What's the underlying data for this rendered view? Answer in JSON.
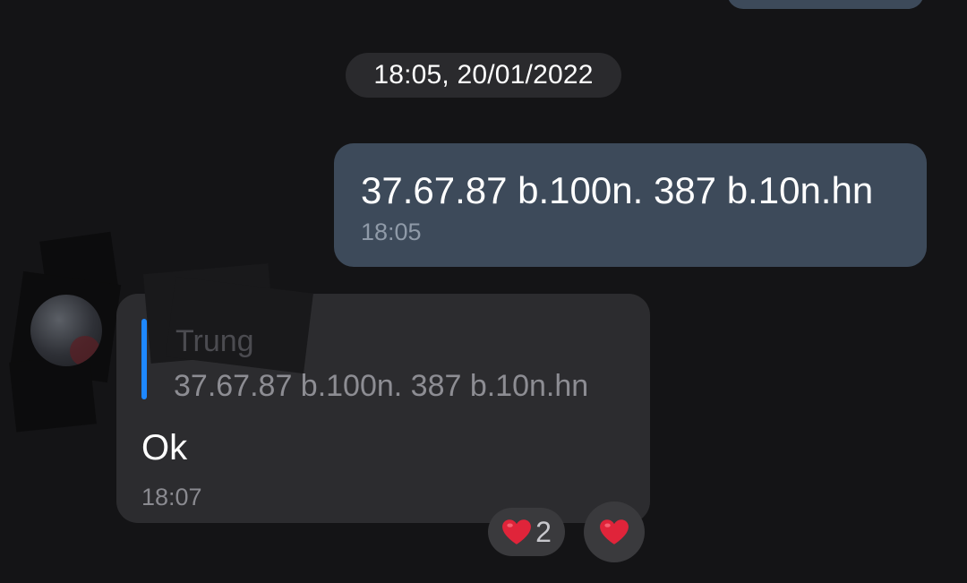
{
  "chat": {
    "date_chip": "18:05, 20/01/2022",
    "outgoing_message": {
      "text": "37.67.87 b.100n. 387 b.10n.hn",
      "time": "18:05"
    },
    "incoming_message": {
      "reply": {
        "sender": "Trung",
        "quoted_text": "37.67.87 b.100n. 387 b.10n.hn"
      },
      "text": "Ok",
      "time": "18:07",
      "reactions": [
        {
          "emoji": "heart-icon",
          "count": "2"
        }
      ]
    }
  },
  "colors": {
    "background": "#141416",
    "outgoing_bubble": "#3d4a5a",
    "incoming_bubble": "#2c2c2f",
    "reply_accent": "#1e88ff",
    "heart": "#e0243a"
  }
}
